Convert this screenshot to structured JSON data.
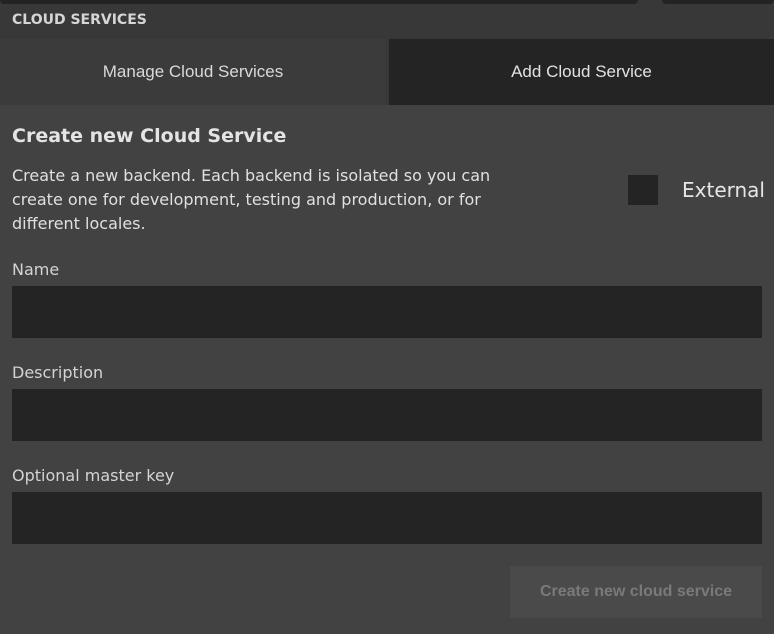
{
  "header": {
    "title": "CLOUD SERVICES"
  },
  "tabs": [
    {
      "label": "Manage Cloud Services",
      "active": false
    },
    {
      "label": "Add Cloud Service",
      "active": true
    }
  ],
  "form": {
    "heading": "Create new Cloud Service",
    "description": "Create a new backend. Each backend is isolated so you can create one for development, testing and production, or for different locales.",
    "external": {
      "label": "External",
      "checked": false
    },
    "fields": {
      "name": {
        "label": "Name",
        "value": ""
      },
      "description": {
        "label": "Description",
        "value": ""
      },
      "master_key": {
        "label": "Optional master key",
        "value": ""
      }
    },
    "submit_label": "Create new cloud service"
  },
  "colors": {
    "background": "#424242",
    "header": "#383838",
    "input": "#242424",
    "active_tab": "#242424",
    "disabled_button": "#4a4a4a"
  }
}
